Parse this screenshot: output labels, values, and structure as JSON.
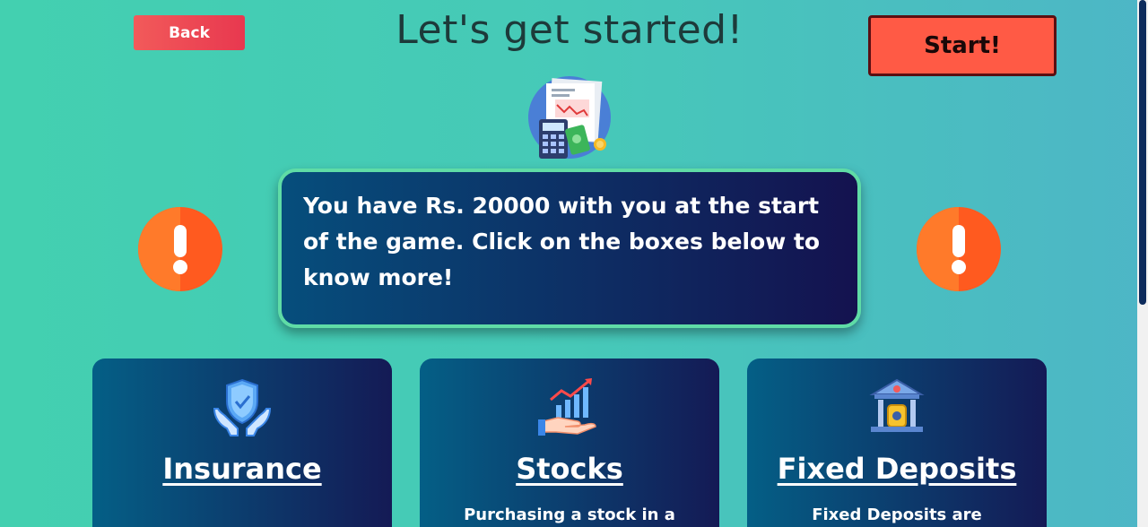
{
  "header": {
    "back_label": "Back",
    "title": "Let's get started!",
    "start_label": "Start!"
  },
  "info": {
    "message": "You have Rs. 20000 with you at the start of the game. Click on the boxes below to know more!"
  },
  "cards": [
    {
      "title": "Insurance",
      "description": "",
      "icon": "insurance-hands-shield-icon"
    },
    {
      "title": "Stocks",
      "description": "Purchasing a stock in a",
      "icon": "stocks-growth-hand-icon"
    },
    {
      "title": "Fixed Deposits",
      "description": "Fixed Deposits are",
      "icon": "bank-building-icon"
    }
  ],
  "colors": {
    "background_start": "#43d0b0",
    "background_end": "#4db6c6",
    "back_button": "#e8384f",
    "start_button": "#ff5a45",
    "alert": "#ff5a1f",
    "info_border": "#5fdca6",
    "card_gradient_start": "#045f86",
    "card_gradient_end": "#141a55"
  }
}
